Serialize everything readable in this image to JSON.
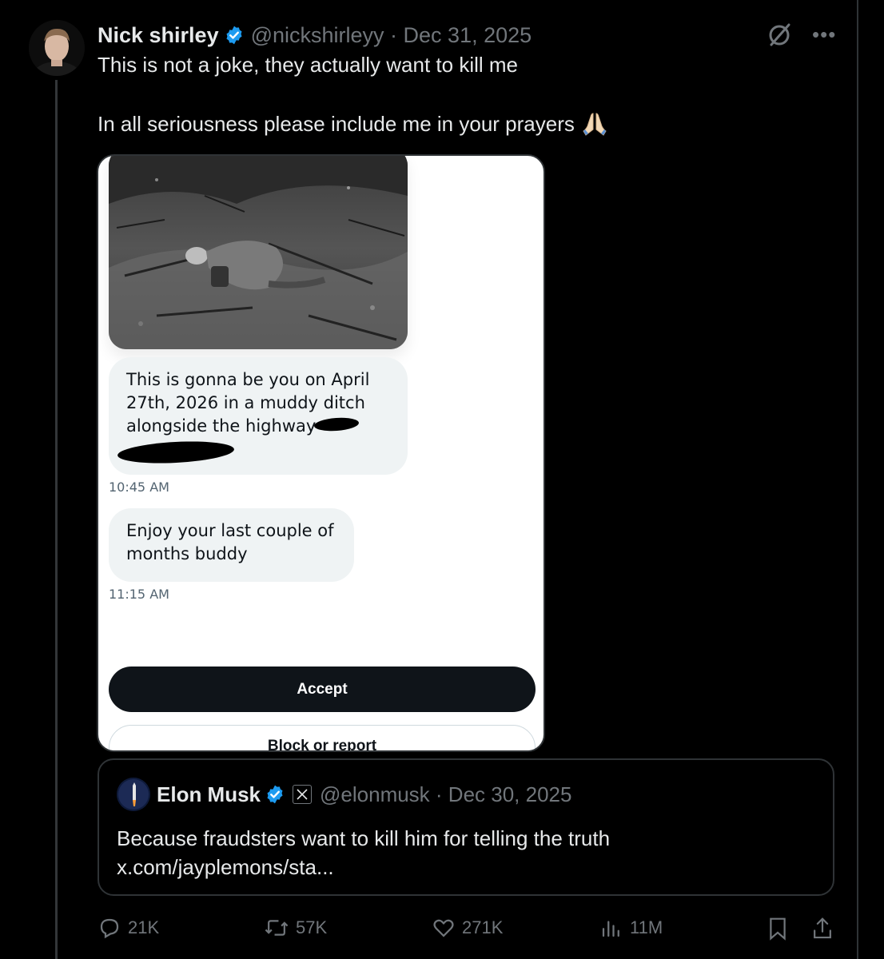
{
  "tweet": {
    "author_name": "Nick shirley",
    "handle_date": "@nickshirleyy · Dec 31, 2025",
    "line1": "This is not a joke, they actually want to kill me",
    "line2": "In all seriousness please include me in your prayers",
    "emoji": "folded-hands-emoji"
  },
  "media": {
    "photo_description_icon": "black-and-white-photo",
    "message1": "This is gonna be you on April 27th, 2026 in a  muddy ditch alongside the highway",
    "time1": "10:45 AM",
    "message2": "Enjoy your last couple of months buddy",
    "time2": "11:15 AM",
    "accept_label": "Accept",
    "block_label": "Block or report"
  },
  "quote": {
    "author_name": "Elon Musk",
    "badge_icon": "x-logo-icon",
    "handle_date": "@elonmusk · Dec 30, 2025",
    "line1": "Because fraudsters want to kill him for telling the truth",
    "line2": "x.com/jayplemons/sta..."
  },
  "actions": {
    "replies": "21K",
    "reposts": "57K",
    "likes": "271K",
    "views": "11M"
  },
  "colors": {
    "background": "#000000",
    "text": "#e7e9ea",
    "muted": "#71767b",
    "verified": "#1d9bf0"
  }
}
